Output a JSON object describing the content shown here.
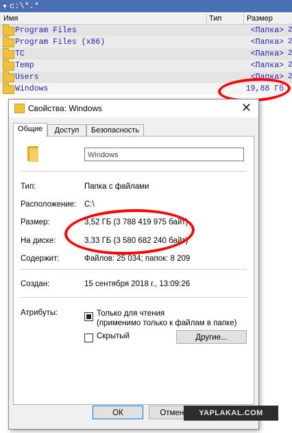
{
  "file_manager": {
    "path": "c:\\*.*",
    "columns": {
      "name": "Имя",
      "type": "Тип",
      "size": "Размер"
    },
    "rows": [
      {
        "name": "Program Files",
        "size": "<Папка>",
        "edge": "2"
      },
      {
        "name": "Program Files (x86)",
        "size": "<Папка>",
        "edge": "2"
      },
      {
        "name": "TC",
        "size": "<Папка>",
        "edge": "2"
      },
      {
        "name": "Temp",
        "size": "<Папка>",
        "edge": "2"
      },
      {
        "name": "Users",
        "size": "<Папка>",
        "edge": "2"
      },
      {
        "name": "Windows",
        "size": "19,88 Гб",
        "edge": ""
      }
    ]
  },
  "dialog": {
    "title": "Свойства: Windows",
    "close_glyph": "✕",
    "tabs": [
      "Общие",
      "Доступ",
      "Безопасность"
    ],
    "folder_name": "Windows",
    "props": {
      "type_label": "Тип:",
      "type_value": "Папка с файлами",
      "location_label": "Расположение:",
      "location_value": "C:\\",
      "size_label": "Размер:",
      "size_value": "3,52 ГБ (3 788 419 975 байт)",
      "disk_label": "На диске:",
      "disk_value": "3,33 ГБ (3 580 682 240 байт)",
      "contains_label": "Содержит:",
      "contains_value": "Файлов: 25 034; папок: 8 209",
      "created_label": "Создан:",
      "created_value": "15 сентября 2018 г., 13:09:26",
      "attributes_label": "Атрибуты:"
    },
    "readonly_label_1": "Только для чтения",
    "readonly_label_2": "(применимо только к файлам в папке)",
    "hidden_label": "Скрытый",
    "other_button": "Другие...",
    "ok_button": "ОК",
    "cancel_button": "Отмена"
  },
  "watermark": "YAPLAKAL.COM",
  "colors": {
    "annotation": "#ff0000",
    "file_text": "#2222a8",
    "path_bar": "#4a6fb5"
  }
}
